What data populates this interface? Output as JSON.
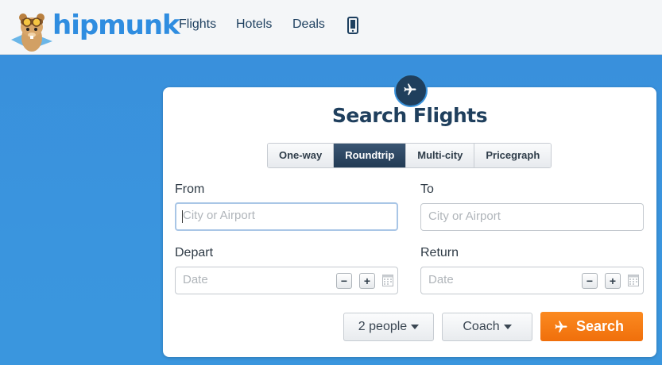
{
  "header": {
    "logo_text": "hipmunk",
    "nav": {
      "flights": "Flights",
      "hotels": "Hotels",
      "deals": "Deals"
    },
    "icons": {
      "mascot": "chipmunk-mascot-icon",
      "mobile": "mobile-phone-icon"
    }
  },
  "search": {
    "title": "Search Flights",
    "tabs": [
      {
        "label": "One-way",
        "active": false
      },
      {
        "label": "Roundtrip",
        "active": true
      },
      {
        "label": "Multi-city",
        "active": false
      },
      {
        "label": "Pricegraph",
        "active": false
      }
    ],
    "from": {
      "label": "From",
      "placeholder": "City or Airport",
      "value": ""
    },
    "to": {
      "label": "To",
      "placeholder": "City or Airport",
      "value": ""
    },
    "depart": {
      "label": "Depart",
      "placeholder": "Date",
      "minus": "−",
      "plus": "+"
    },
    "return": {
      "label": "Return",
      "placeholder": "Date",
      "minus": "−",
      "plus": "+"
    },
    "passengers": {
      "value": "2 people"
    },
    "cabin": {
      "value": "Coach"
    },
    "submit": {
      "label": "Search"
    }
  },
  "colors": {
    "brand_blue": "#2f8de0",
    "background": "#3a93dc",
    "navy": "#1f3f5d",
    "orange": "#f47a14"
  }
}
